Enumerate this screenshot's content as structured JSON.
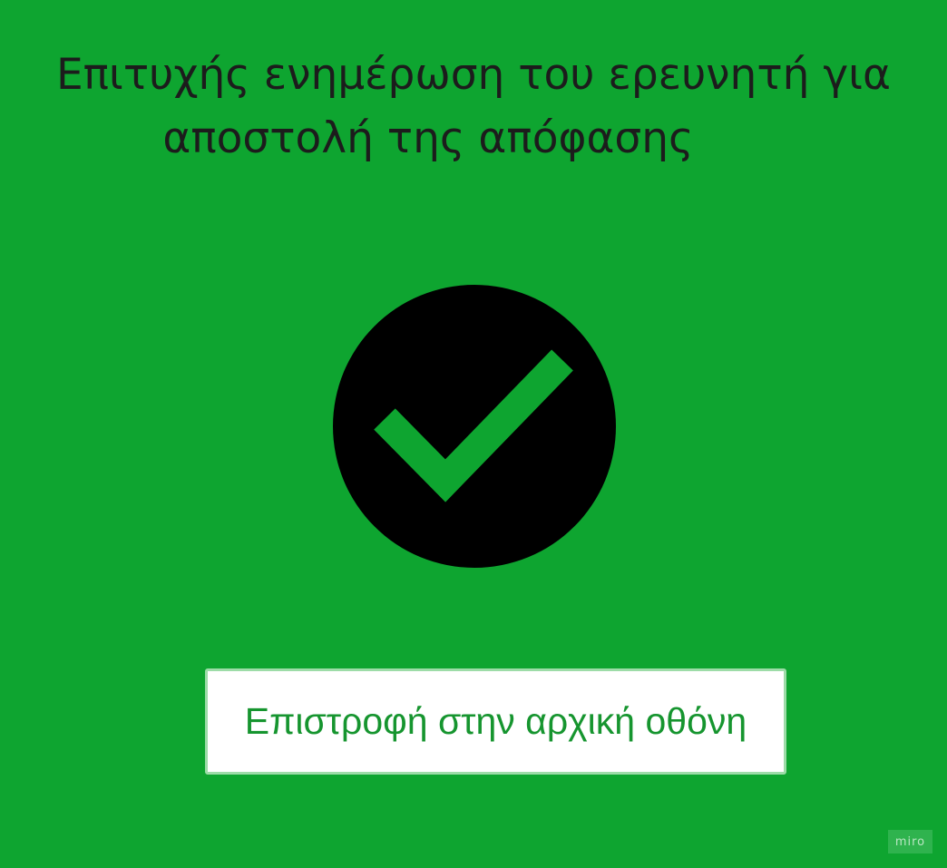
{
  "screen": {
    "title_line1": "Επιτυχής ενημέρωση του ερευνητή για",
    "title_line2": "αποστολή της απόφασης",
    "status_icon": "check-icon",
    "home_button_label": "Επιστροφή στην αρχική οθόνη",
    "watermark": "miro"
  },
  "colors": {
    "background": "#0ea530",
    "icon_circle": "#000000",
    "checkmark": "#0ea530",
    "button_background": "#ffffff",
    "button_text": "#16952f"
  }
}
